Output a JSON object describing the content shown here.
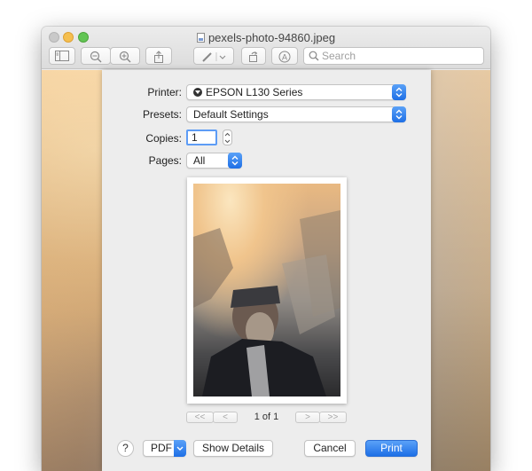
{
  "window": {
    "title": "pexels-photo-94860.jpeg"
  },
  "toolbar": {
    "search_placeholder": "Search"
  },
  "print": {
    "printer_label": "Printer:",
    "printer_value": "EPSON L130 Series",
    "presets_label": "Presets:",
    "presets_value": "Default Settings",
    "copies_label": "Copies:",
    "copies_value": "1",
    "pages_label": "Pages:",
    "pages_value": "All",
    "page_indicator": "1 of 1",
    "help_label": "?",
    "pdf_label": "PDF",
    "show_details_label": "Show Details",
    "cancel_label": "Cancel",
    "print_label": "Print"
  },
  "colors": {
    "accent": "#1d6fe6",
    "focus_ring": "#5d9cf5"
  }
}
